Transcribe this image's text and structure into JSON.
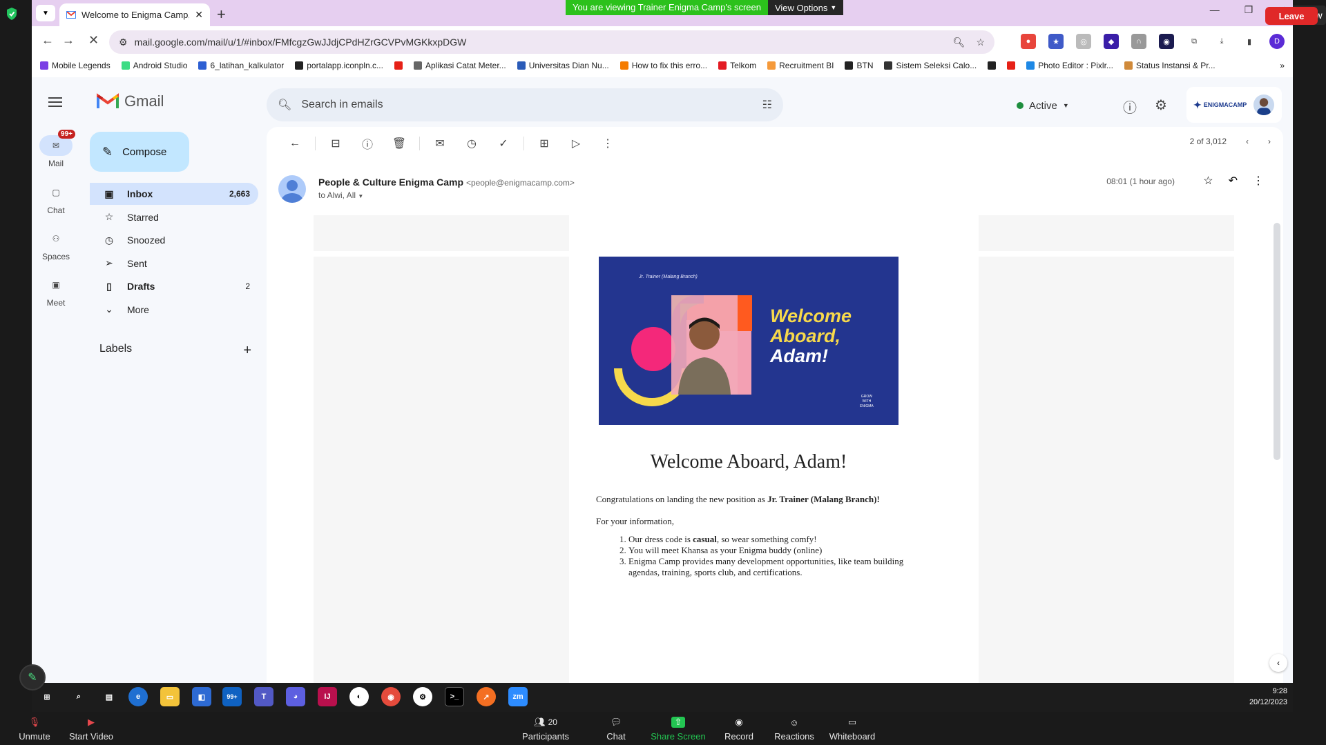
{
  "zoom": {
    "banner_text": "You are viewing Trainer Enigma Camp's screen",
    "view_options": "View Options",
    "view_label": "View",
    "controls": [
      {
        "label": "Unmute",
        "icon": "mic-muted-icon"
      },
      {
        "label": "Start Video",
        "icon": "video-off-icon"
      },
      {
        "label": "Participants",
        "icon": "participants-icon",
        "count": "20"
      },
      {
        "label": "Chat",
        "icon": "chat-icon"
      },
      {
        "label": "Share Screen",
        "icon": "share-screen-icon"
      },
      {
        "label": "Record",
        "icon": "record-icon"
      },
      {
        "label": "Reactions",
        "icon": "reactions-icon"
      },
      {
        "label": "Whiteboard",
        "icon": "whiteboard-icon"
      }
    ],
    "leave": "Leave"
  },
  "browser": {
    "tab_title": "Welcome to Enigma Camp, Ad",
    "url": "mail.google.com/mail/u/1/#inbox/FMfcgzGwJJdjCPdHZrGCVPvMGKkxpDGW",
    "bookmarks": [
      {
        "label": "Mobile Legends",
        "color": "#7b3fe4"
      },
      {
        "label": "Android Studio",
        "color": "#3ddc84"
      },
      {
        "label": "6_latihan_kalkulator",
        "color": "#2d5fd3"
      },
      {
        "label": "portalapp.iconpln.c...",
        "color": "#222222"
      },
      {
        "label": "",
        "color": "#e62117"
      },
      {
        "label": "Aplikasi Catat Meter...",
        "color": "#666666"
      },
      {
        "label": "Universitas Dian Nu...",
        "color": "#2a5bb8"
      },
      {
        "label": "How to fix this erro...",
        "color": "#f57c00"
      },
      {
        "label": "Telkom",
        "color": "#e31b23"
      },
      {
        "label": "Recruitment BI",
        "color": "#f59a3b"
      },
      {
        "label": "BTN",
        "color": "#222222"
      },
      {
        "label": "Sistem Seleksi Calo...",
        "color": "#333333"
      },
      {
        "label": "",
        "color": "#222222"
      },
      {
        "label": "",
        "color": "#e62117"
      },
      {
        "label": "Photo Editor : Pixlr...",
        "color": "#1e88e5"
      },
      {
        "label": "Status Instansi & Pr...",
        "color": "#d08a3a"
      }
    ]
  },
  "gmail": {
    "product": "Gmail",
    "rail": [
      {
        "label": "Mail",
        "badge": "99+"
      },
      {
        "label": "Chat"
      },
      {
        "label": "Spaces"
      },
      {
        "label": "Meet"
      }
    ],
    "search_placeholder": "Search in emails",
    "status": "Active",
    "compose": "Compose",
    "nav": [
      {
        "label": "Inbox",
        "count": "2,663",
        "icon": "inbox-icon"
      },
      {
        "label": "Starred",
        "count": "",
        "icon": "star-icon"
      },
      {
        "label": "Snoozed",
        "count": "",
        "icon": "clock-icon"
      },
      {
        "label": "Sent",
        "count": "",
        "icon": "send-icon"
      },
      {
        "label": "Drafts",
        "count": "2",
        "icon": "draft-icon"
      },
      {
        "label": "More",
        "count": "",
        "icon": "chevron-down-icon"
      }
    ],
    "labels_header": "Labels",
    "org_logo": "ENIGMACAMP",
    "pager": "2 of 3,012",
    "message": {
      "sender_name": "People & Culture Enigma Camp",
      "sender_email": "<people@enigmacamp.com>",
      "recipients": "to Alwi, All",
      "time": "08:01 (1 hour ago)",
      "banner_role": "Jr. Trainer (Malang Branch)",
      "banner_line1": "Welcome",
      "banner_line2": "Aboard,",
      "banner_line3": "Adam!",
      "banner_tagline": [
        "GROW",
        "WITH",
        "ENIGMA"
      ],
      "title": "Welcome Aboard, Adam!",
      "congrats_prefix": "Congratulations on landing the new position as ",
      "position": "Jr. Trainer (Malang Branch)!",
      "info": "For your information,",
      "items": [
        {
          "pre": "Our dress code is ",
          "bold": "casual",
          "post": ", so wear something comfy!"
        },
        {
          "pre": "You will meet Khansa as your Enigma buddy (online)",
          "bold": "",
          "post": ""
        },
        {
          "pre": "Enigma Camp provides many development opportunities, like team building agendas, training, sports club, and certifications.",
          "bold": "",
          "post": ""
        }
      ]
    }
  },
  "taskbar": {
    "badge": "99+",
    "time": "9:28",
    "date": "20/12/2023"
  }
}
